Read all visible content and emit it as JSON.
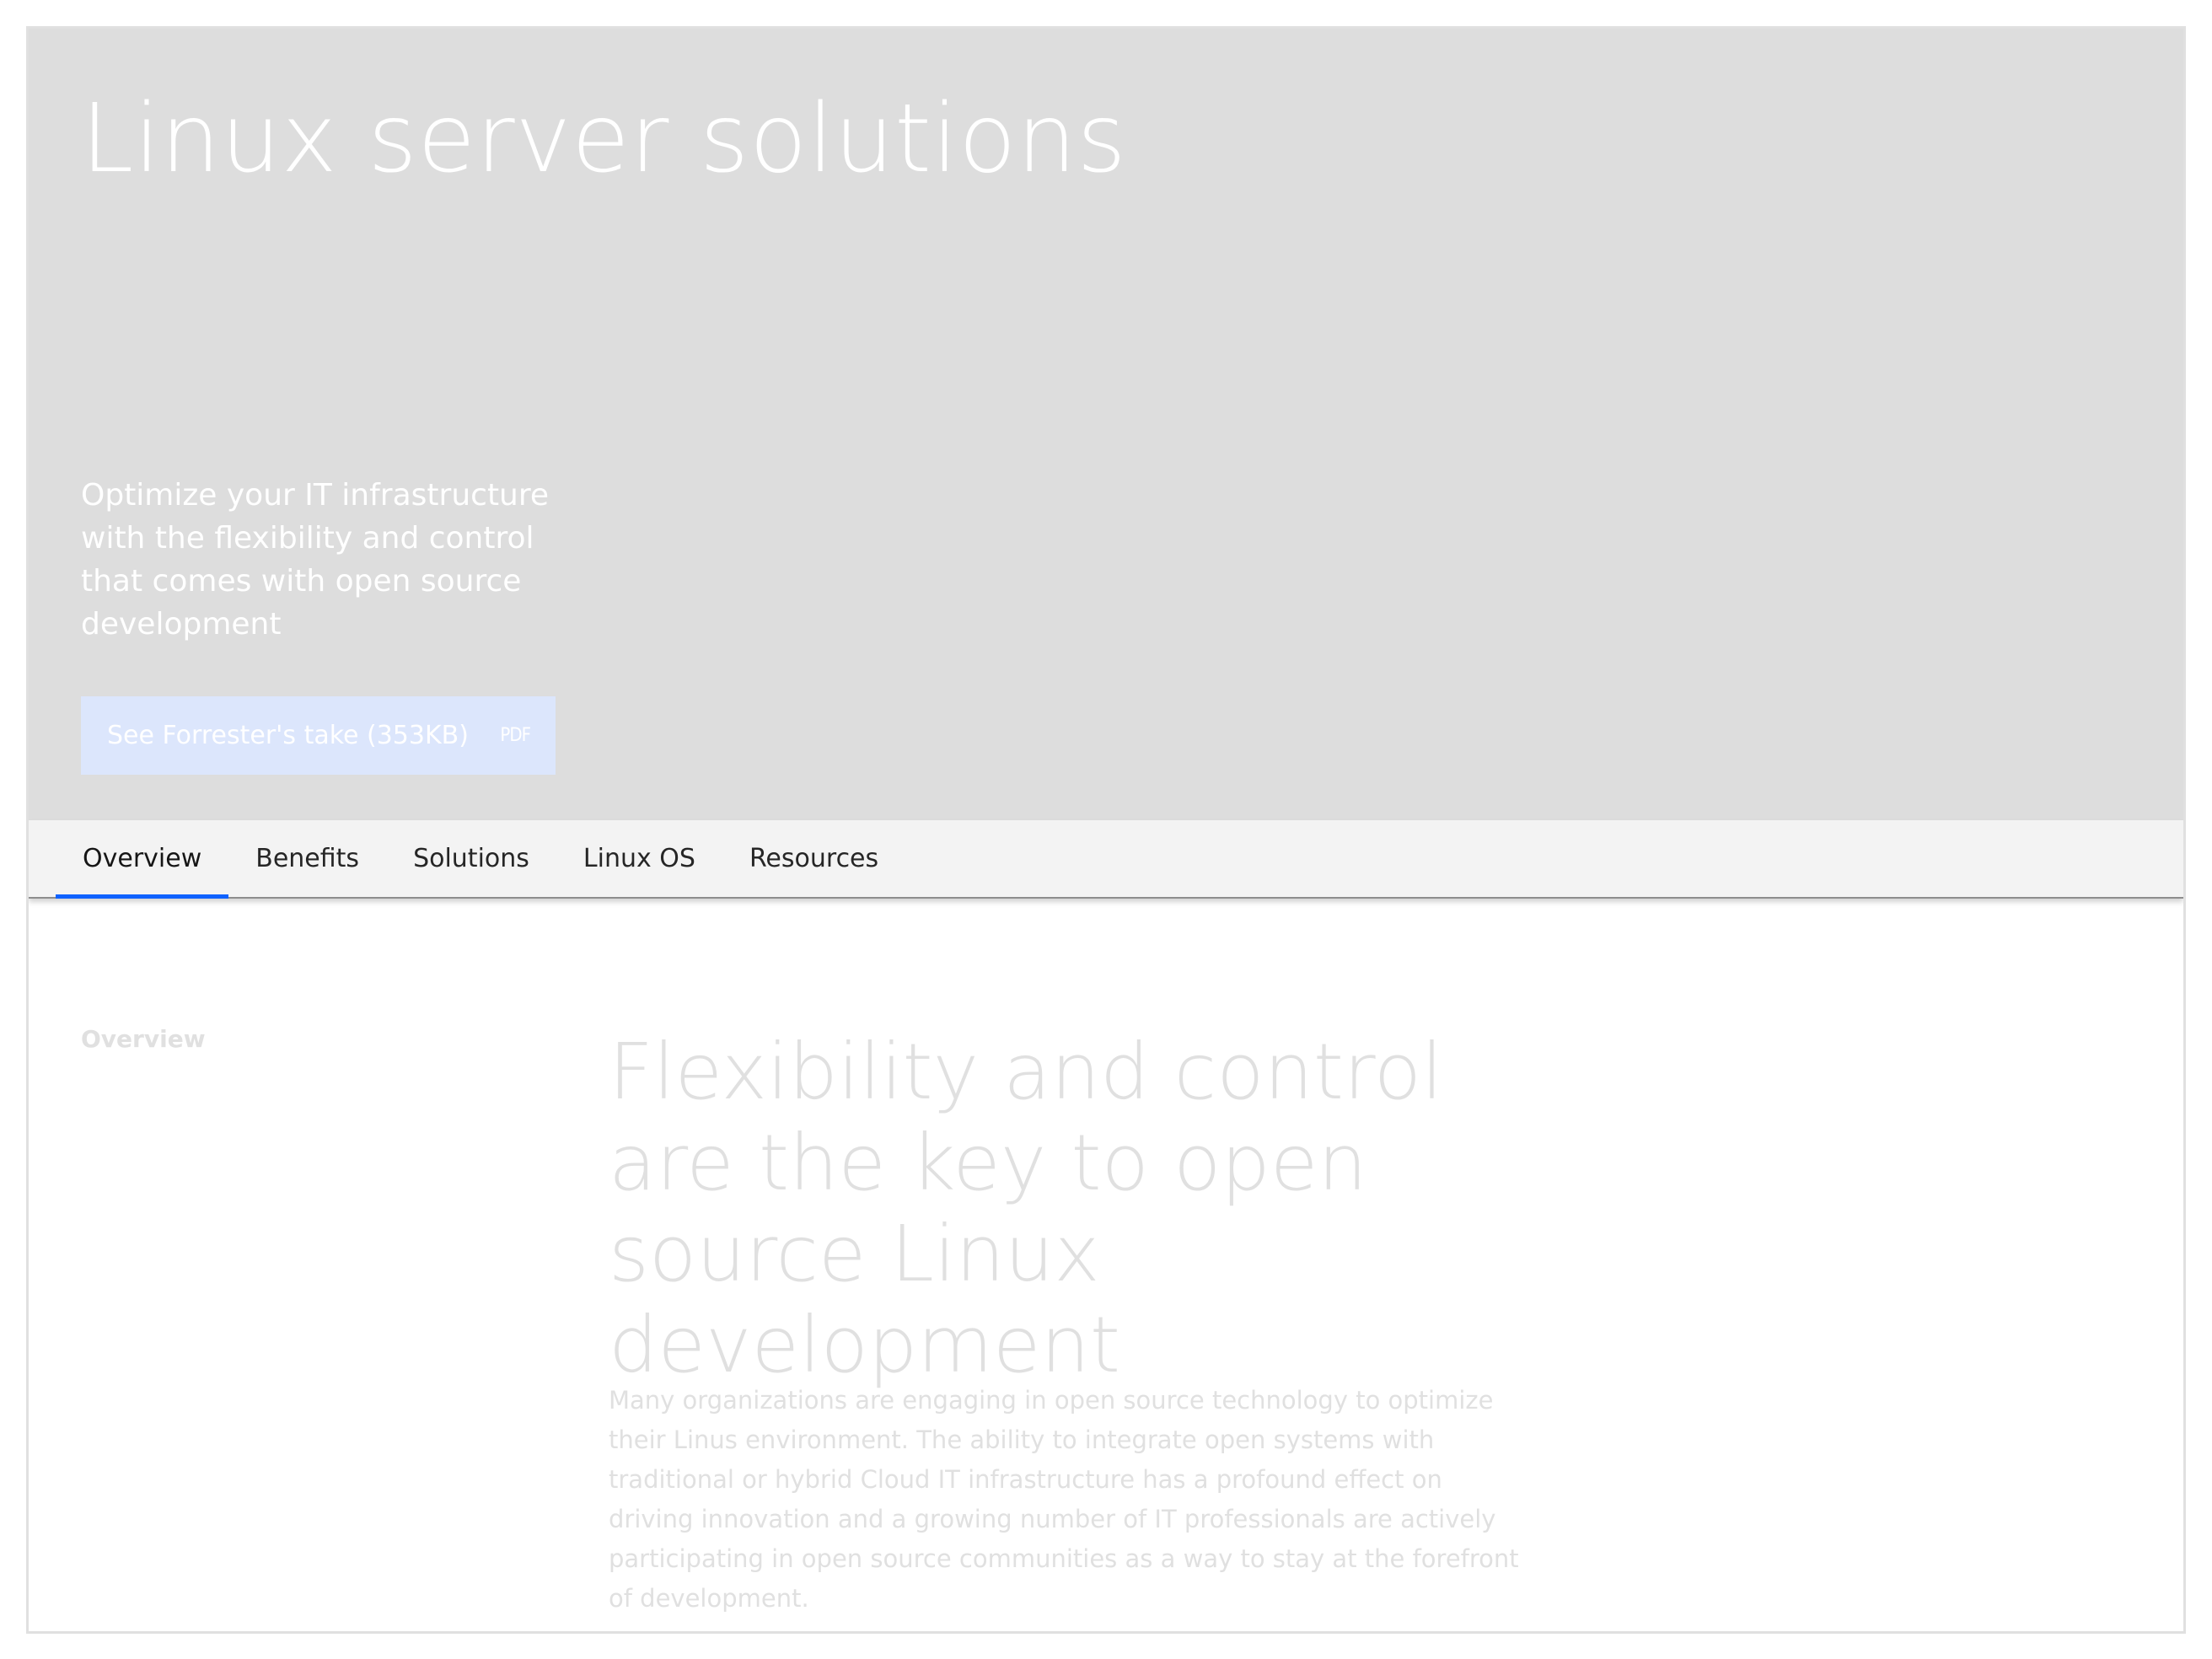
{
  "hero": {
    "title": "Linux server solutions",
    "subtitle": "Optimize your IT infrastructure with the flexibility and control that comes with open source development",
    "cta": {
      "label": "See Forrester's take (353KB)",
      "icon_text": "PDF",
      "icon": "pdf-icon"
    },
    "background_color": "#dddddd"
  },
  "tabs": [
    {
      "label": "Overview",
      "active": true
    },
    {
      "label": "Benefits",
      "active": false
    },
    {
      "label": "Solutions",
      "active": false
    },
    {
      "label": "Linux OS",
      "active": false
    },
    {
      "label": "Resources",
      "active": false
    }
  ],
  "overview": {
    "side_label": "Overview",
    "heading": "Flexibility and control are the key to open source Linux development",
    "body": "Many organizations are engaging in open source technology to optimize their Linus environment. The ability to integrate open systems with traditional or hybrid Cloud IT infrastructure has a profound effect on driving innovation and a growing number of IT professionals are actively participating in open source communities as a way to stay at the forefront of development."
  },
  "colors": {
    "accent": "#0f62fe",
    "cta_background": "#dce6fc",
    "faded_text": "#e0e0e0"
  }
}
